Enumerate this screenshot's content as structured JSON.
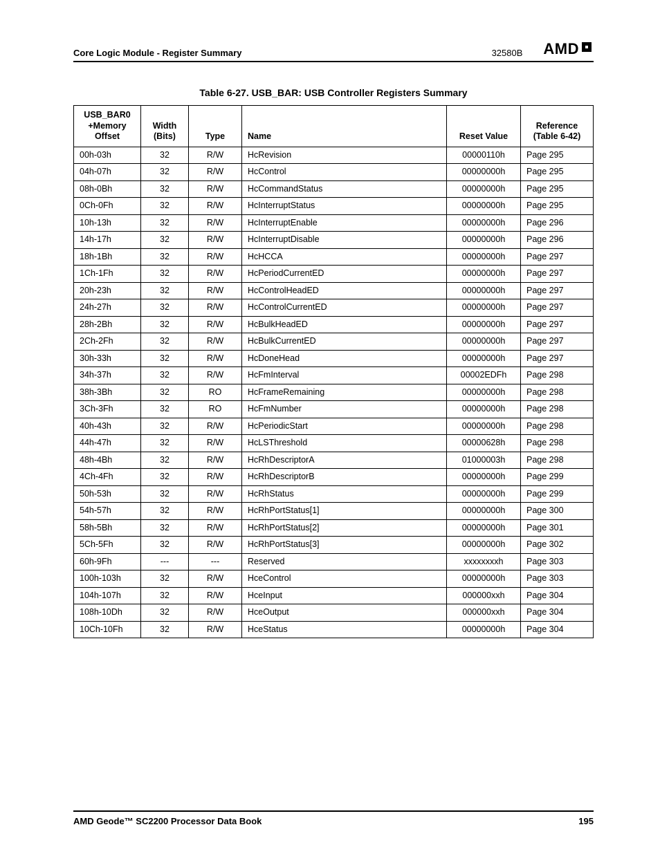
{
  "header": {
    "section": "Core Logic Module - Register Summary",
    "docnum": "32580B",
    "logo": "AMD"
  },
  "table": {
    "caption": "Table 6-27.  USB_BAR: USB Controller Registers Summary",
    "headers": {
      "offset": "USB_BAR0\n+Memory\nOffset",
      "width": "Width\n(Bits)",
      "type": "Type",
      "name": "Name",
      "reset": "Reset Value",
      "ref": "Reference\n(Table 6-42)"
    },
    "rows": [
      {
        "offset": "00h-03h",
        "width": "32",
        "type": "R/W",
        "name": "HcRevision",
        "reset": "00000110h",
        "ref": "Page 295"
      },
      {
        "offset": "04h-07h",
        "width": "32",
        "type": "R/W",
        "name": "HcControl",
        "reset": "00000000h",
        "ref": "Page 295"
      },
      {
        "offset": "08h-0Bh",
        "width": "32",
        "type": "R/W",
        "name": "HcCommandStatus",
        "reset": "00000000h",
        "ref": "Page 295"
      },
      {
        "offset": "0Ch-0Fh",
        "width": "32",
        "type": "R/W",
        "name": "HcInterruptStatus",
        "reset": "00000000h",
        "ref": "Page 295"
      },
      {
        "offset": "10h-13h",
        "width": "32",
        "type": "R/W",
        "name": "HcInterruptEnable",
        "reset": "00000000h",
        "ref": "Page 296"
      },
      {
        "offset": "14h-17h",
        "width": "32",
        "type": "R/W",
        "name": "HcInterruptDisable",
        "reset": "00000000h",
        "ref": "Page 296"
      },
      {
        "offset": "18h-1Bh",
        "width": "32",
        "type": "R/W",
        "name": "HcHCCA",
        "reset": "00000000h",
        "ref": "Page 297"
      },
      {
        "offset": "1Ch-1Fh",
        "width": "32",
        "type": "R/W",
        "name": "HcPeriodCurrentED",
        "reset": "00000000h",
        "ref": "Page 297"
      },
      {
        "offset": "20h-23h",
        "width": "32",
        "type": "R/W",
        "name": "HcControlHeadED",
        "reset": "00000000h",
        "ref": "Page 297"
      },
      {
        "offset": "24h-27h",
        "width": "32",
        "type": "R/W",
        "name": "HcControlCurrentED",
        "reset": "00000000h",
        "ref": "Page 297"
      },
      {
        "offset": "28h-2Bh",
        "width": "32",
        "type": "R/W",
        "name": "HcBulkHeadED",
        "reset": "00000000h",
        "ref": "Page 297"
      },
      {
        "offset": "2Ch-2Fh",
        "width": "32",
        "type": "R/W",
        "name": "HcBulkCurrentED",
        "reset": "00000000h",
        "ref": "Page 297"
      },
      {
        "offset": "30h-33h",
        "width": "32",
        "type": "R/W",
        "name": "HcDoneHead",
        "reset": "00000000h",
        "ref": "Page 297"
      },
      {
        "offset": "34h-37h",
        "width": "32",
        "type": "R/W",
        "name": "HcFmInterval",
        "reset": "00002EDFh",
        "ref": "Page 298"
      },
      {
        "offset": "38h-3Bh",
        "width": "32",
        "type": "RO",
        "name": "HcFrameRemaining",
        "reset": "00000000h",
        "ref": "Page 298"
      },
      {
        "offset": "3Ch-3Fh",
        "width": "32",
        "type": "RO",
        "name": "HcFmNumber",
        "reset": "00000000h",
        "ref": "Page 298"
      },
      {
        "offset": "40h-43h",
        "width": "32",
        "type": "R/W",
        "name": "HcPeriodicStart",
        "reset": "00000000h",
        "ref": "Page 298"
      },
      {
        "offset": "44h-47h",
        "width": "32",
        "type": "R/W",
        "name": "HcLSThreshold",
        "reset": "00000628h",
        "ref": "Page 298"
      },
      {
        "offset": "48h-4Bh",
        "width": "32",
        "type": "R/W",
        "name": "HcRhDescriptorA",
        "reset": "01000003h",
        "ref": "Page 298"
      },
      {
        "offset": "4Ch-4Fh",
        "width": "32",
        "type": "R/W",
        "name": "HcRhDescriptorB",
        "reset": "00000000h",
        "ref": "Page 299"
      },
      {
        "offset": "50h-53h",
        "width": "32",
        "type": "R/W",
        "name": "HcRhStatus",
        "reset": "00000000h",
        "ref": "Page 299"
      },
      {
        "offset": "54h-57h",
        "width": "32",
        "type": "R/W",
        "name": "HcRhPortStatus[1]",
        "reset": "00000000h",
        "ref": "Page 300"
      },
      {
        "offset": "58h-5Bh",
        "width": "32",
        "type": "R/W",
        "name": "HcRhPortStatus[2]",
        "reset": "00000000h",
        "ref": "Page 301"
      },
      {
        "offset": "5Ch-5Fh",
        "width": "32",
        "type": "R/W",
        "name": "HcRhPortStatus[3]",
        "reset": "00000000h",
        "ref": "Page 302"
      },
      {
        "offset": "60h-9Fh",
        "width": "---",
        "type": "---",
        "name": "Reserved",
        "reset": "xxxxxxxxh",
        "ref": "Page 303"
      },
      {
        "offset": "100h-103h",
        "width": "32",
        "type": "R/W",
        "name": "HceControl",
        "reset": "00000000h",
        "ref": "Page 303"
      },
      {
        "offset": "104h-107h",
        "width": "32",
        "type": "R/W",
        "name": "HceInput",
        "reset": "000000xxh",
        "ref": "Page 304"
      },
      {
        "offset": "108h-10Dh",
        "width": "32",
        "type": "R/W",
        "name": "HceOutput",
        "reset": "000000xxh",
        "ref": "Page 304"
      },
      {
        "offset": "10Ch-10Fh",
        "width": "32",
        "type": "R/W",
        "name": "HceStatus",
        "reset": "00000000h",
        "ref": "Page 304"
      }
    ]
  },
  "footer": {
    "left": "AMD Geode™ SC2200  Processor Data Book",
    "right": "195"
  }
}
